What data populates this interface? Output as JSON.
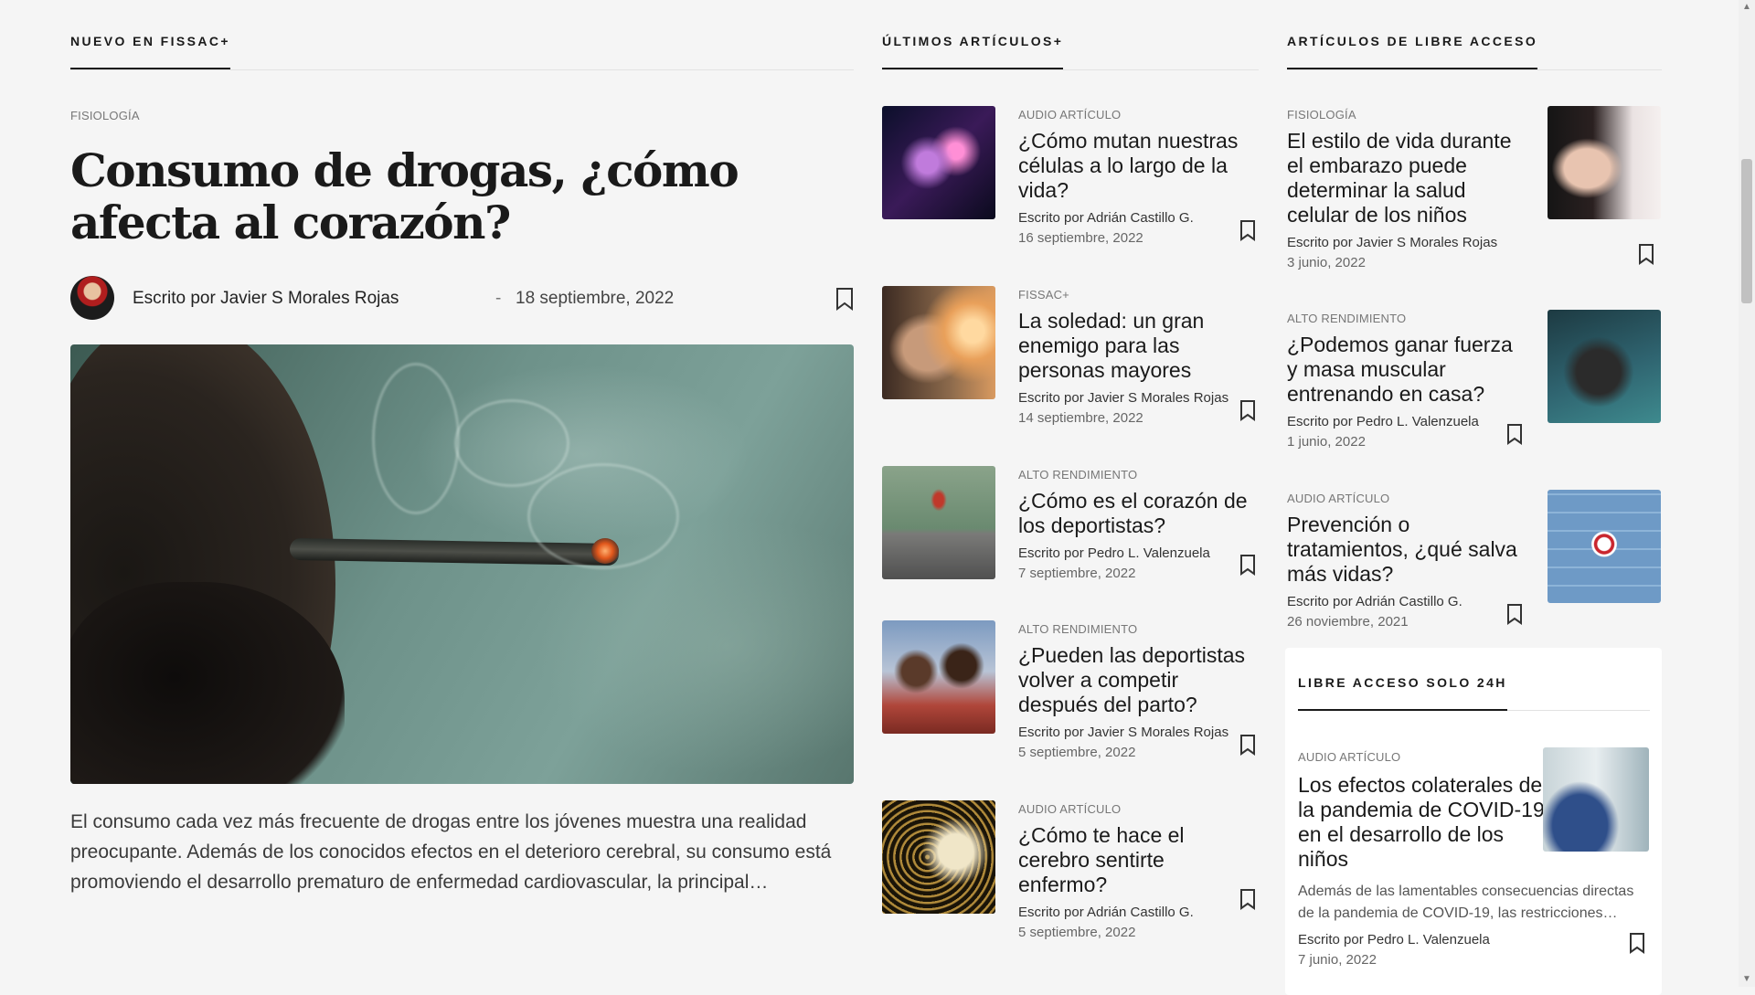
{
  "sections": {
    "new": "NUEVO EN FISSAC+",
    "latest": "ÚLTIMOS ARTÍCULOS+",
    "free": "ARTÍCULOS DE LIBRE ACCESO"
  },
  "featured": {
    "category": "FISIOLOGÍA",
    "title": "Consumo de drogas, ¿cómo afecta al corazón?",
    "author": "Escrito por Javier S Morales Rojas",
    "separator": "-",
    "date": "18 septiembre, 2022",
    "excerpt": "El consumo cada vez más frecuente de drogas entre los jóvenes muestra una realidad preocupante. Además de los conocidos efectos en el deterioro cerebral, su consumo está promoviendo el desarrollo prematuro de enfermedad cardiovascular, la principal…"
  },
  "latest": [
    {
      "category": "AUDIO ARTÍCULO",
      "title": "¿Cómo mutan nuestras células a lo largo de la vida?",
      "author": "Escrito por Adrián Castillo G.",
      "date": "16 septiembre, 2022",
      "image": "dna-strand"
    },
    {
      "category": "FISSAC+",
      "title": "La soledad: un gran enemigo para las personas mayores",
      "author": "Escrito por Javier S Morales Rojas",
      "date": "14 septiembre, 2022",
      "image": "elderly-man-sunset"
    },
    {
      "category": "ALTO RENDIMIENTO",
      "title": "¿Cómo es el corazón de los deportistas?",
      "author": "Escrito por Pedro L. Valenzuela",
      "date": "7 septiembre, 2022",
      "image": "runner"
    },
    {
      "category": "ALTO RENDIMIENTO",
      "title": "¿Pueden las deportistas volver a competir después del parto?",
      "author": "Escrito por Javier S Morales Rojas",
      "date": "5 septiembre, 2022",
      "image": "athlete-mother"
    },
    {
      "category": "AUDIO ARTÍCULO",
      "title": "¿Cómo te hace el cerebro sentirte enfermo?",
      "author": "Escrito por Adrián Castillo G.",
      "date": "5 septiembre, 2022",
      "image": "golden-brain"
    }
  ],
  "free": [
    {
      "category": "FISIOLOGÍA",
      "title": "El estilo de vida durante el embarazo puede determinar la salud celular de los niños",
      "author": "Escrito por Javier S Morales Rojas",
      "date": "3 junio, 2022",
      "image": "pregnant-belly"
    },
    {
      "category": "ALTO RENDIMIENTO",
      "title": "¿Podemos ganar fuerza y masa muscular entrenando en casa?",
      "author": "Escrito por Pedro L. Valenzuela",
      "date": "1 junio, 2022",
      "image": "home-workout"
    },
    {
      "category": "AUDIO ARTÍCULO",
      "title": "Prevención o tratamientos, ¿qué salva más vidas?",
      "author": "Escrito por Adrián Castillo G.",
      "date": "26 noviembre, 2021",
      "image": "red-cross-ceiling"
    }
  ],
  "special": {
    "heading": "LIBRE ACCESO SOLO 24H",
    "category": "AUDIO ARTÍCULO",
    "title": "Los efectos colaterales de la pandemia de COVID-19 en el desarrollo de los niños",
    "excerpt": "Además de las lamentables consecuencias directas de la pandemia de COVID-19, las restricciones…",
    "author": "Escrito por Pedro L. Valenzuela",
    "date": "7 junio, 2022",
    "image": "child-in-bed"
  },
  "icons": {
    "bookmark": "bookmark-icon",
    "scroll_up": "▲",
    "scroll_down": "▼"
  },
  "colors": {
    "background": "#f5f5f5",
    "text": "#1a1a1a",
    "muted": "#777777"
  }
}
